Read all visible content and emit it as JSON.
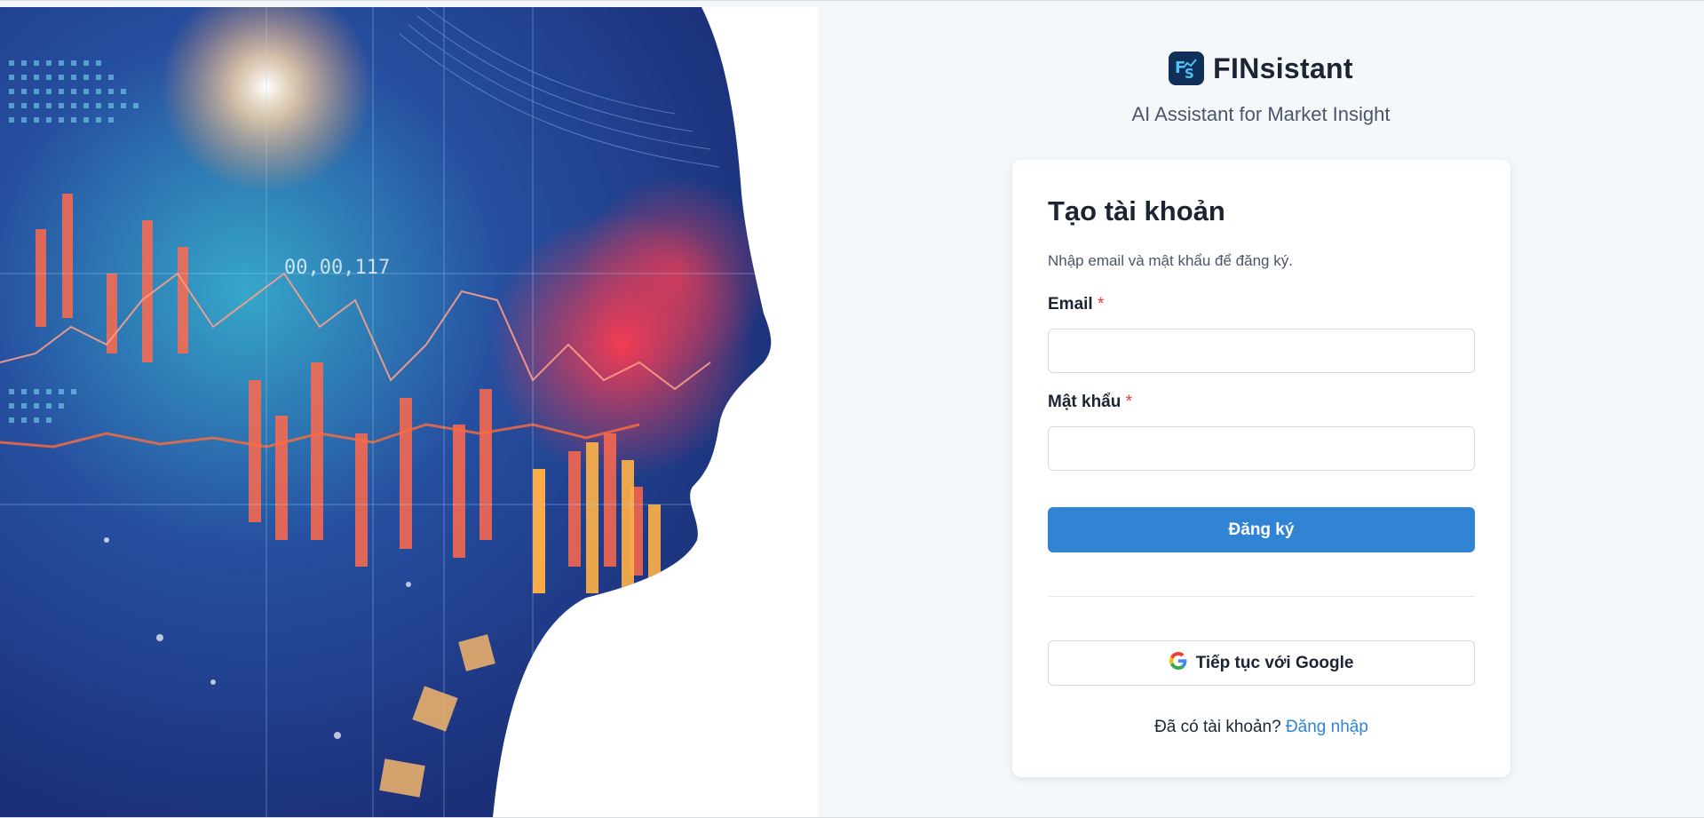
{
  "brand": {
    "name": "FINsistant",
    "tagline": "AI Assistant for Market Insight",
    "logo_icon": "fs-logo-icon",
    "logo_bg": "#10305a"
  },
  "hero": {
    "image_alt": "ai-head-financial-charts-image",
    "overlay_text": "00,00,117"
  },
  "card": {
    "title": "Tạo tài khoản",
    "subtitle": "Nhập email và mật khẩu để đăng ký.",
    "email": {
      "label": "Email",
      "required_mark": "*",
      "value": "",
      "placeholder": ""
    },
    "password": {
      "label": "Mật khẩu",
      "required_mark": "*",
      "value": "",
      "placeholder": ""
    },
    "submit_label": "Đăng ký",
    "google_label": "Tiếp tục với Google",
    "google_icon": "google-icon",
    "footer_text": "Đã có tài khoản?",
    "footer_link": "Đăng nhập"
  },
  "colors": {
    "primary": "#3183d4",
    "page_bg": "#f5f8fb",
    "required": "#e53935"
  }
}
